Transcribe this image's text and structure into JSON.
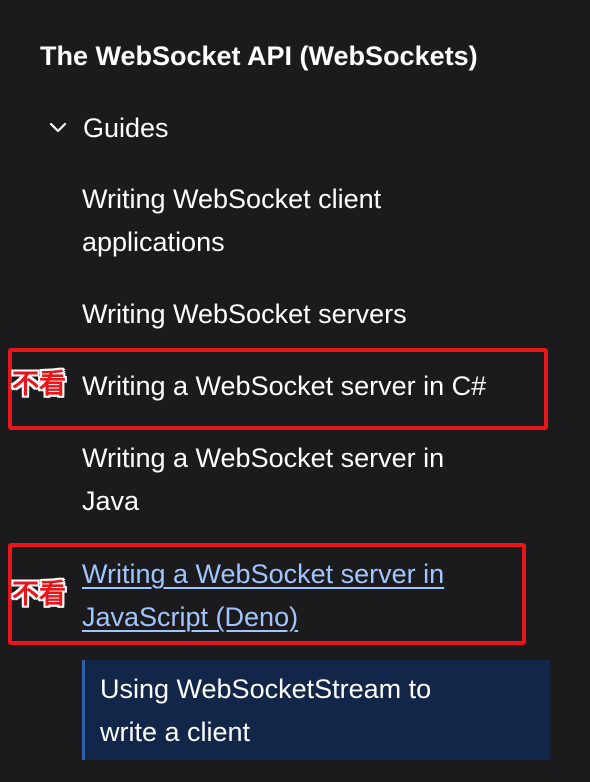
{
  "sidebar": {
    "section_title": "The WebSocket API (WebSockets)",
    "group": {
      "label": "Guides",
      "icon": "chevron-down-icon",
      "items": [
        {
          "label_lines": [
            "Writing WebSocket client",
            "applications"
          ]
        },
        {
          "label_lines": [
            "Writing WebSocket servers"
          ]
        },
        {
          "label_lines": [
            "Writing a WebSocket server in C#"
          ]
        },
        {
          "label_lines": [
            "Writing a WebSocket server in",
            "Java"
          ]
        },
        {
          "label_lines": [
            "Writing a WebSocket server in",
            "JavaScript (Deno)"
          ]
        },
        {
          "label_lines": [
            "Using WebSocketStream to",
            "write a client"
          ]
        }
      ]
    }
  },
  "annotations": {
    "label_1": "不看",
    "label_2": "不看",
    "color": "#e8161b"
  },
  "colors": {
    "background": "#1b1b1d",
    "link": "#a0c4ff",
    "active_bg": "#12264a",
    "active_border": "#2f5fa8"
  }
}
